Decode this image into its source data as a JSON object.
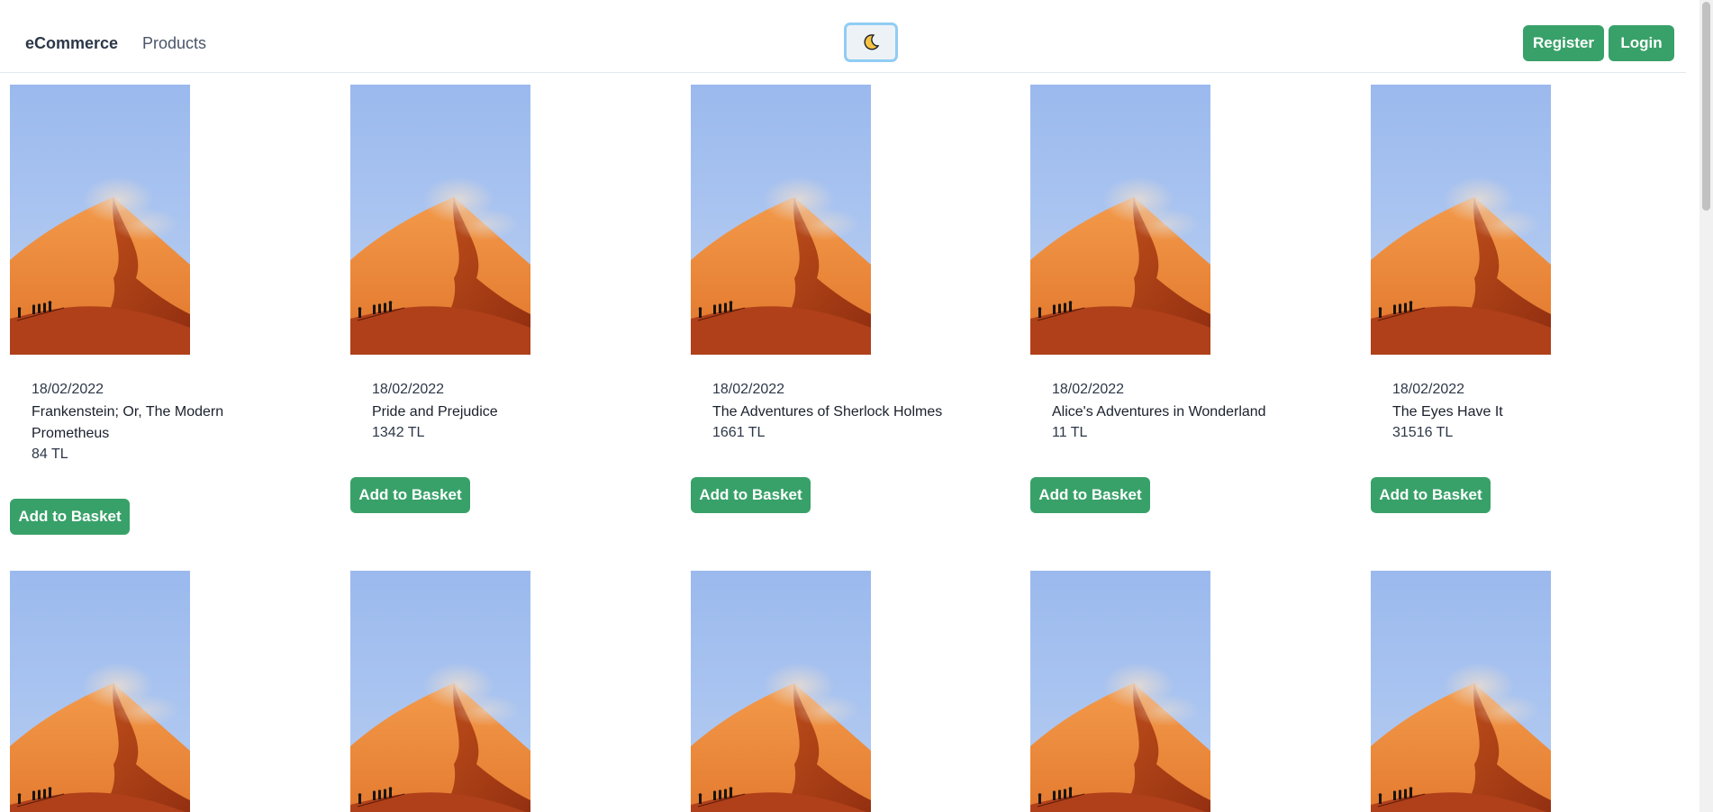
{
  "navbar": {
    "brand": "eCommerce",
    "products_link": "Products",
    "register_label": "Register",
    "login_label": "Login",
    "theme_icon": "moon-icon"
  },
  "products": [
    {
      "date": "18/02/2022",
      "title": "Frankenstein; Or, The Modern Prometheus",
      "price": "84 TL",
      "button": "Add to Basket"
    },
    {
      "date": "18/02/2022",
      "title": "Pride and Prejudice",
      "price": "1342 TL",
      "button": "Add to Basket"
    },
    {
      "date": "18/02/2022",
      "title": "The Adventures of Sherlock Holmes",
      "price": "1661 TL",
      "button": "Add to Basket"
    },
    {
      "date": "18/02/2022",
      "title": "Alice's Adventures in Wonderland",
      "price": "11 TL",
      "button": "Add to Basket"
    },
    {
      "date": "18/02/2022",
      "title": "The Eyes Have It",
      "price": "31516 TL",
      "button": "Add to Basket"
    }
  ],
  "colors": {
    "accent": "#38a169",
    "toggle_border": "#90cdf4",
    "toggle_bg": "#edf2f7"
  }
}
